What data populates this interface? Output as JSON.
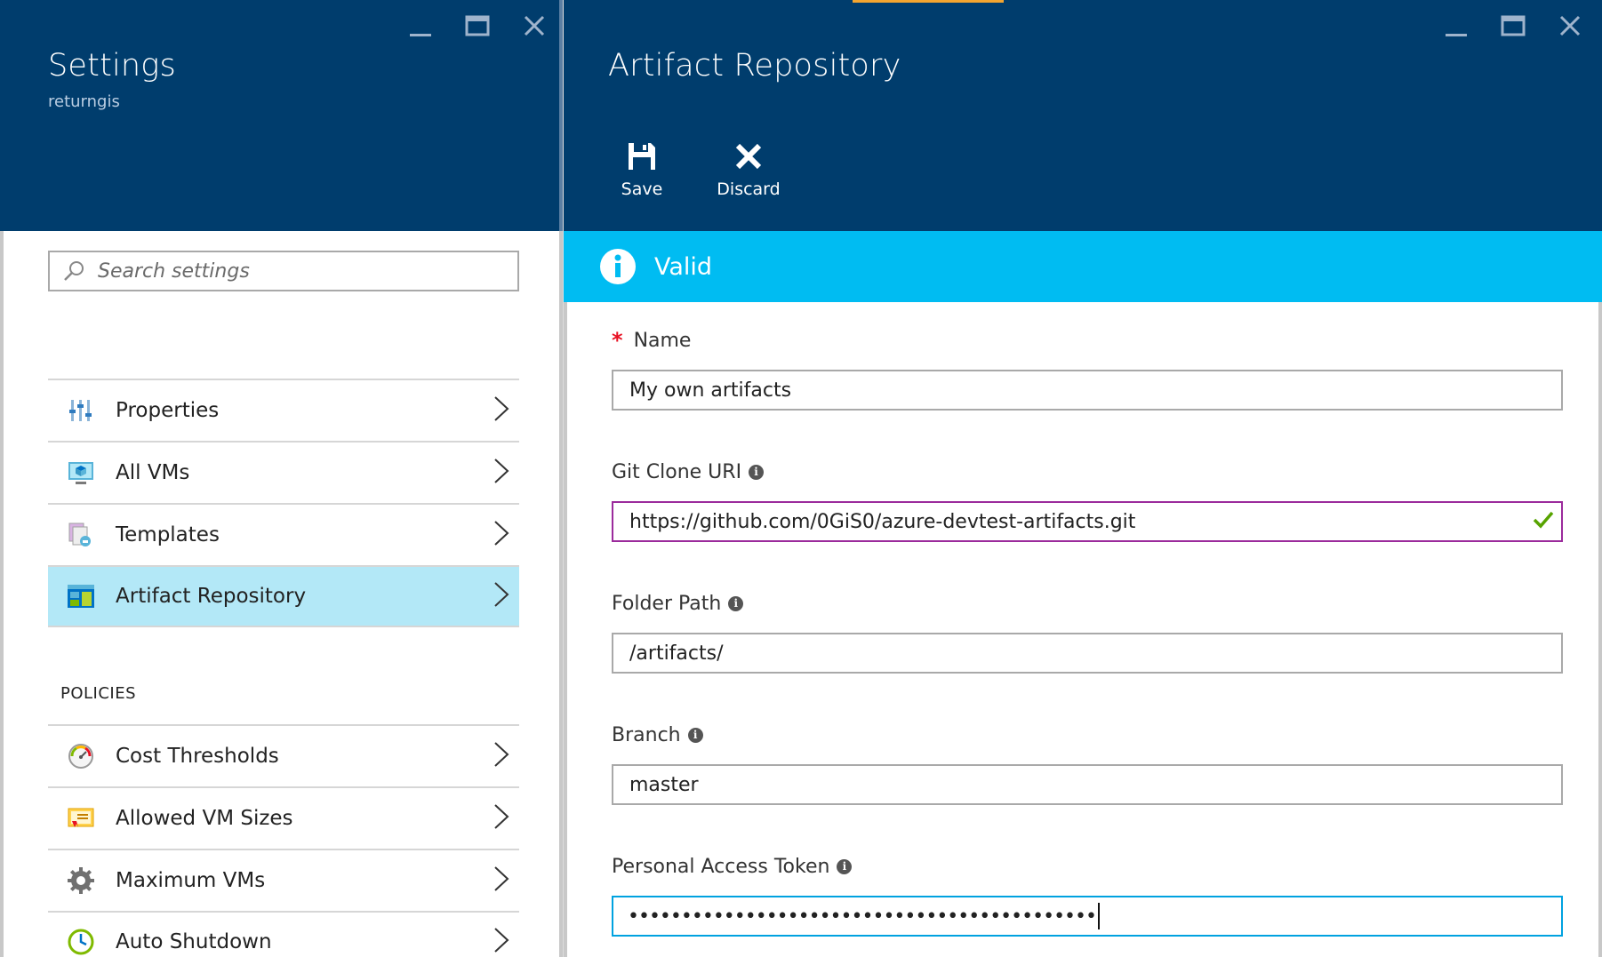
{
  "settings_blade": {
    "title": "Settings",
    "subtitle": "returngis",
    "search": {
      "placeholder": "Search settings",
      "value": ""
    },
    "menu_items": [
      {
        "label": "Properties",
        "icon": "properties-icon",
        "selected": false
      },
      {
        "label": "All VMs",
        "icon": "vm-icon",
        "selected": false
      },
      {
        "label": "Templates",
        "icon": "templates-icon",
        "selected": false
      },
      {
        "label": "Artifact Repository",
        "icon": "artifact-repository-icon",
        "selected": true
      }
    ],
    "policies_label": "POLICIES",
    "policy_items": [
      {
        "label": "Cost Thresholds",
        "icon": "gauge-icon"
      },
      {
        "label": "Allowed VM Sizes",
        "icon": "vm-sizes-icon"
      },
      {
        "label": "Maximum VMs",
        "icon": "gear-icon"
      },
      {
        "label": "Auto Shutdown",
        "icon": "clock-icon"
      }
    ]
  },
  "artifact_blade": {
    "title": "Artifact Repository",
    "toolbar": {
      "save_label": "Save",
      "discard_label": "Discard"
    },
    "status": {
      "text": "Valid"
    },
    "fields": {
      "name": {
        "label": "Name",
        "value": "My own artifacts",
        "required": "*"
      },
      "git_clone_uri": {
        "label": "Git Clone URI",
        "value": "https://github.com/0GiS0/azure-devtest-artifacts.git"
      },
      "folder_path": {
        "label": "Folder Path",
        "value": "/artifacts/"
      },
      "branch": {
        "label": "Branch",
        "value": "master"
      },
      "personal_access_token": {
        "label": "Personal Access Token",
        "value": "••••••••••••••••••••••••••••••••••••••••••••"
      }
    }
  },
  "colors": {
    "header_bg": "#003d6d",
    "info_bar": "#00bcf2",
    "selected_item": "#b3e8f7",
    "valid_border": "#9b2b9c",
    "focus_border": "#00a2e0",
    "required": "#e81123",
    "check": "#57a300"
  }
}
